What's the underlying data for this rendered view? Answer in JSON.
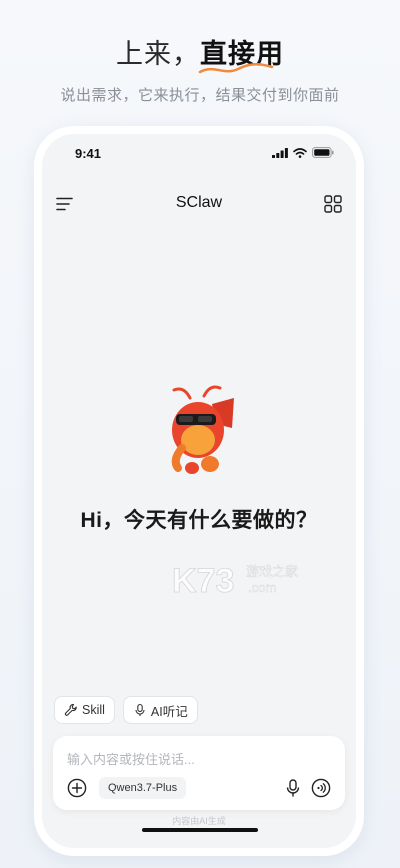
{
  "promo": {
    "title_normal": "上来，",
    "title_strong": "直接用",
    "subtitle": "说出需求，它来执行，结果交付到你面前"
  },
  "status_bar": {
    "time": "9:41"
  },
  "nav": {
    "title": "SClaw"
  },
  "main": {
    "greeting": "Hi，今天有什么要做的？"
  },
  "chips": [
    {
      "label": "Skill",
      "icon": "wrench-icon"
    },
    {
      "label": "AI听记",
      "icon": "microphone-icon"
    }
  ],
  "composer": {
    "placeholder": "输入内容或按住说话...",
    "model": "Qwen3.7-Plus"
  },
  "footer": {
    "disclaimer": "内容由AI生成"
  },
  "watermark": {
    "text": "K73",
    "site": "游戏之家",
    "domain": ".com"
  },
  "colors": {
    "accent": "#f08a3a",
    "mascot_red": "#e8452c",
    "mascot_orange": "#f7a23a"
  }
}
